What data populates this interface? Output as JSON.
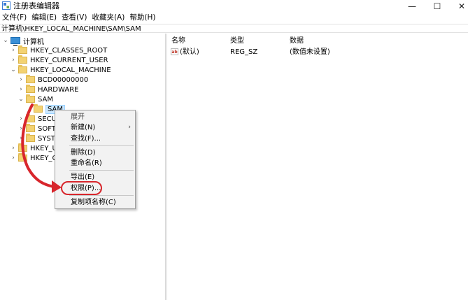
{
  "window": {
    "title": "注册表编辑器",
    "minimize_glyph": "—",
    "maximize_glyph": "☐",
    "close_glyph": "✕"
  },
  "menu": [
    {
      "label": "文件(F)"
    },
    {
      "label": "编辑(E)"
    },
    {
      "label": "查看(V)"
    },
    {
      "label": "收藏夹(A)"
    },
    {
      "label": "帮助(H)"
    }
  ],
  "address": "计算机\\HKEY_LOCAL_MACHINE\\SAM\\SAM",
  "tree": {
    "root": "计算机",
    "nodes": [
      {
        "label": "HKEY_CLASSES_ROOT",
        "expander": "›"
      },
      {
        "label": "HKEY_CURRENT_USER",
        "expander": "›"
      },
      {
        "label": "HKEY_LOCAL_MACHINE",
        "expander": "⌄"
      },
      {
        "label": "BCD00000000",
        "expander": "›"
      },
      {
        "label": "HARDWARE",
        "expander": "›"
      },
      {
        "label": "SAM",
        "expander": "⌄"
      },
      {
        "label": "SAM",
        "expander": ""
      },
      {
        "label": "SECURI",
        "expander": "›"
      },
      {
        "label": "SOFTW",
        "expander": "›"
      },
      {
        "label": "SYSTEM",
        "expander": "›"
      },
      {
        "label": "HKEY_USE",
        "expander": "›"
      },
      {
        "label": "HKEY_CUR",
        "expander": "›"
      }
    ]
  },
  "list": {
    "columns": [
      "名称",
      "类型",
      "数据"
    ],
    "rows": [
      {
        "icon": "ab",
        "name": "(默认)",
        "type": "REG_SZ",
        "data": "(数值未设置)"
      }
    ]
  },
  "context_menu": {
    "items": [
      {
        "label": "展开"
      },
      {
        "label": "新建(N)",
        "submenu_glyph": "›"
      },
      {
        "label": "查找(F)..."
      },
      {
        "label": "删除(D)"
      },
      {
        "label": "重命名(R)"
      },
      {
        "label": "导出(E)"
      },
      {
        "label": "权限(P)..."
      },
      {
        "label": "复制项名称(C)"
      }
    ]
  },
  "annotation_color": "#d8262c"
}
